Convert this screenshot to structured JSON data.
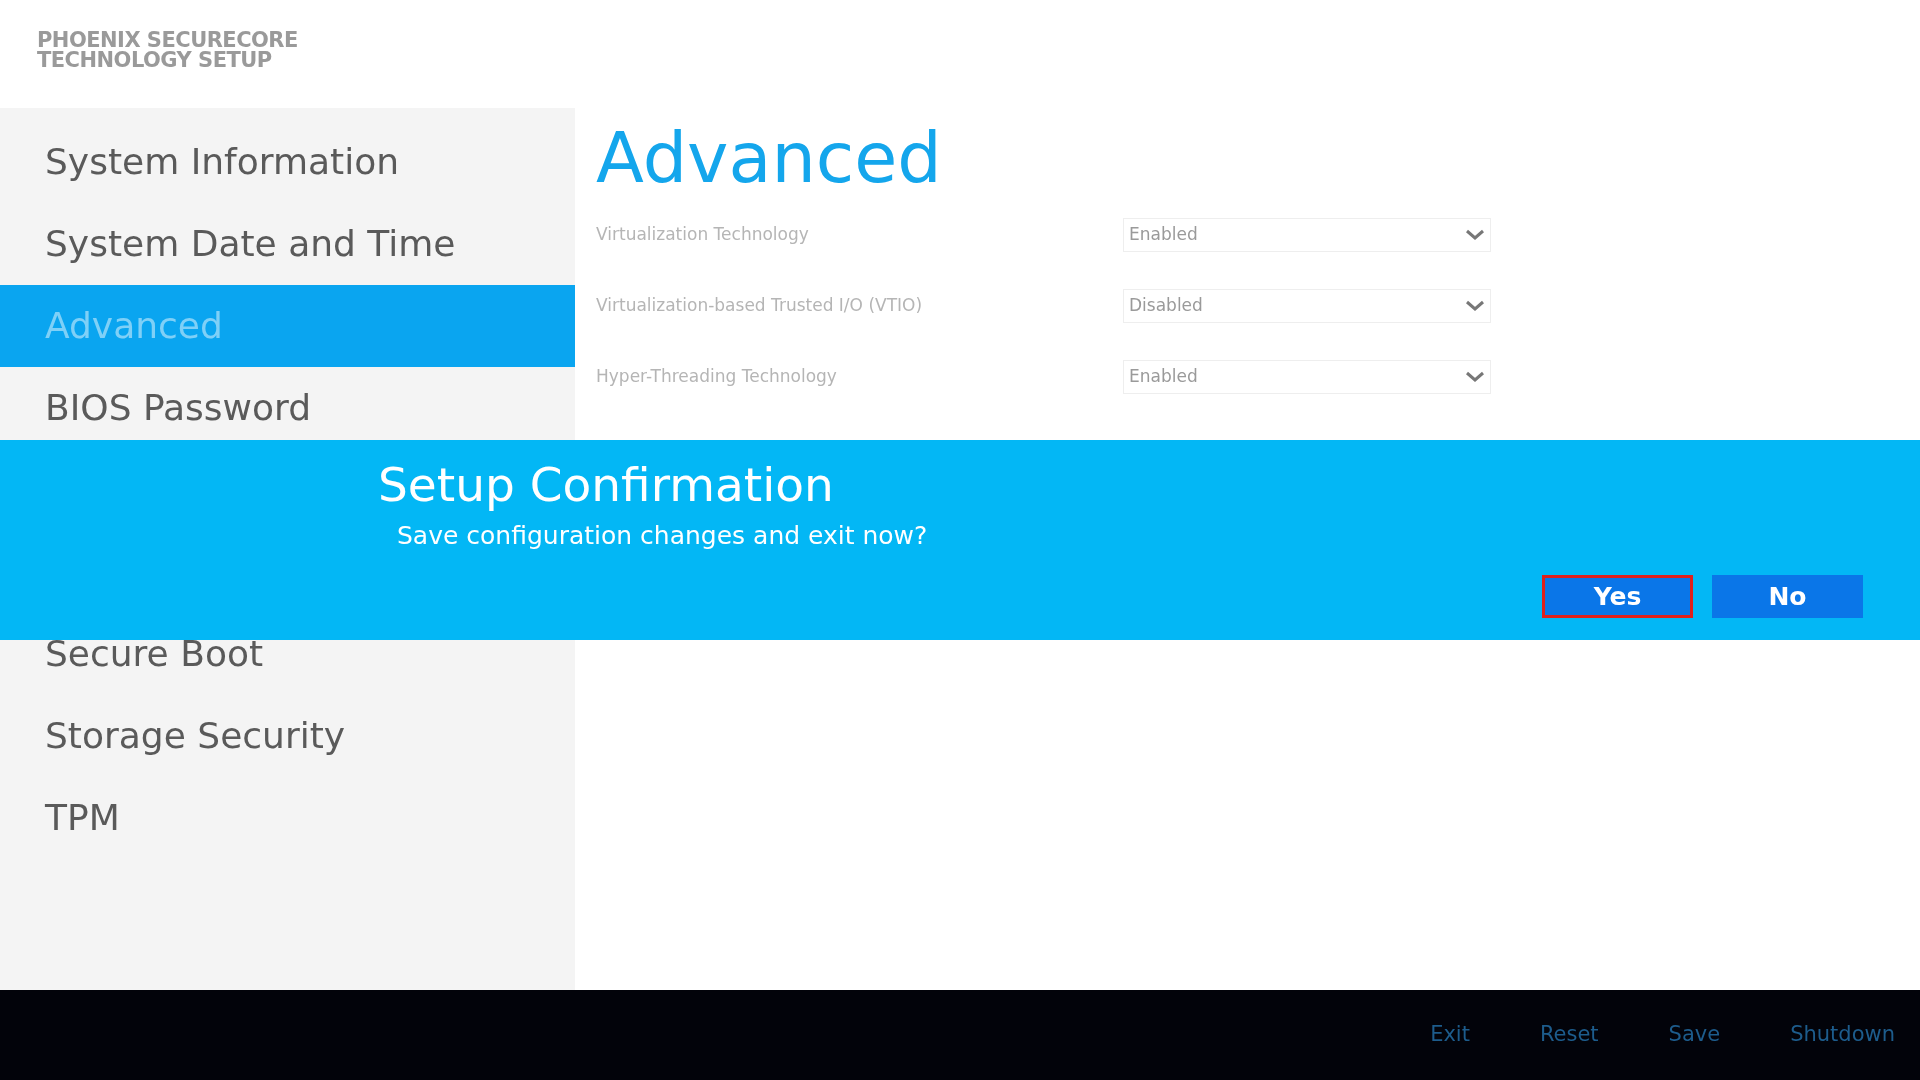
{
  "header": {
    "logo_lines": [
      "PHOENIX SECURECORE",
      "TECHNOLOGY SETUP"
    ]
  },
  "sidebar": {
    "groups": [
      [
        {
          "label": "System Information",
          "selected": false
        },
        {
          "label": "System Date and Time",
          "selected": false
        },
        {
          "label": "Advanced",
          "selected": true
        },
        {
          "label": "BIOS Password",
          "selected": false
        }
      ],
      [
        {
          "label": "Secure Boot",
          "selected": false
        },
        {
          "label": "Storage Security",
          "selected": false
        },
        {
          "label": "TPM",
          "selected": false
        }
      ]
    ]
  },
  "page": {
    "title": "Advanced",
    "settings": [
      {
        "label": "Virtualization Technology",
        "value": "Enabled"
      },
      {
        "label": "Virtualization-based Trusted I/O (VTIO)",
        "value": "Disabled"
      },
      {
        "label": "Hyper-Threading Technology",
        "value": "Enabled"
      }
    ]
  },
  "dialog": {
    "title": "Setup Confirmation",
    "message": "Save configuration changes and exit now?",
    "buttons": [
      {
        "label": "Yes",
        "selected": true
      },
      {
        "label": "No",
        "selected": false
      }
    ]
  },
  "footer": {
    "actions": [
      "Exit",
      "Reset",
      "Save",
      "Shutdown"
    ]
  }
}
